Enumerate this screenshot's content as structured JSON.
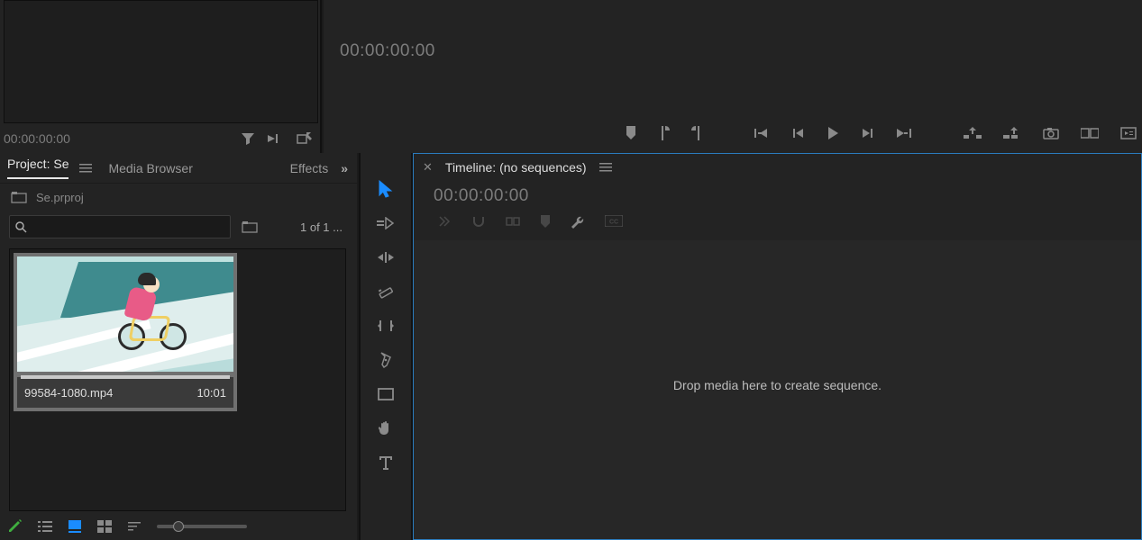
{
  "source": {
    "timecode": "00:00:00:00"
  },
  "program": {
    "timecode": "00:00:00:00"
  },
  "project": {
    "tabs": {
      "active": "Project: Se",
      "browser": "Media Browser",
      "effects": "Effects"
    },
    "file": "Se.prproj",
    "search_placeholder": "",
    "count": "1 of 1 ...",
    "clip": {
      "name": "99584-1080.mp4",
      "duration": "10:01"
    }
  },
  "timeline": {
    "title": "Timeline: (no sequences)",
    "timecode": "00:00:00:00",
    "drop_hint": "Drop media here to create sequence."
  }
}
